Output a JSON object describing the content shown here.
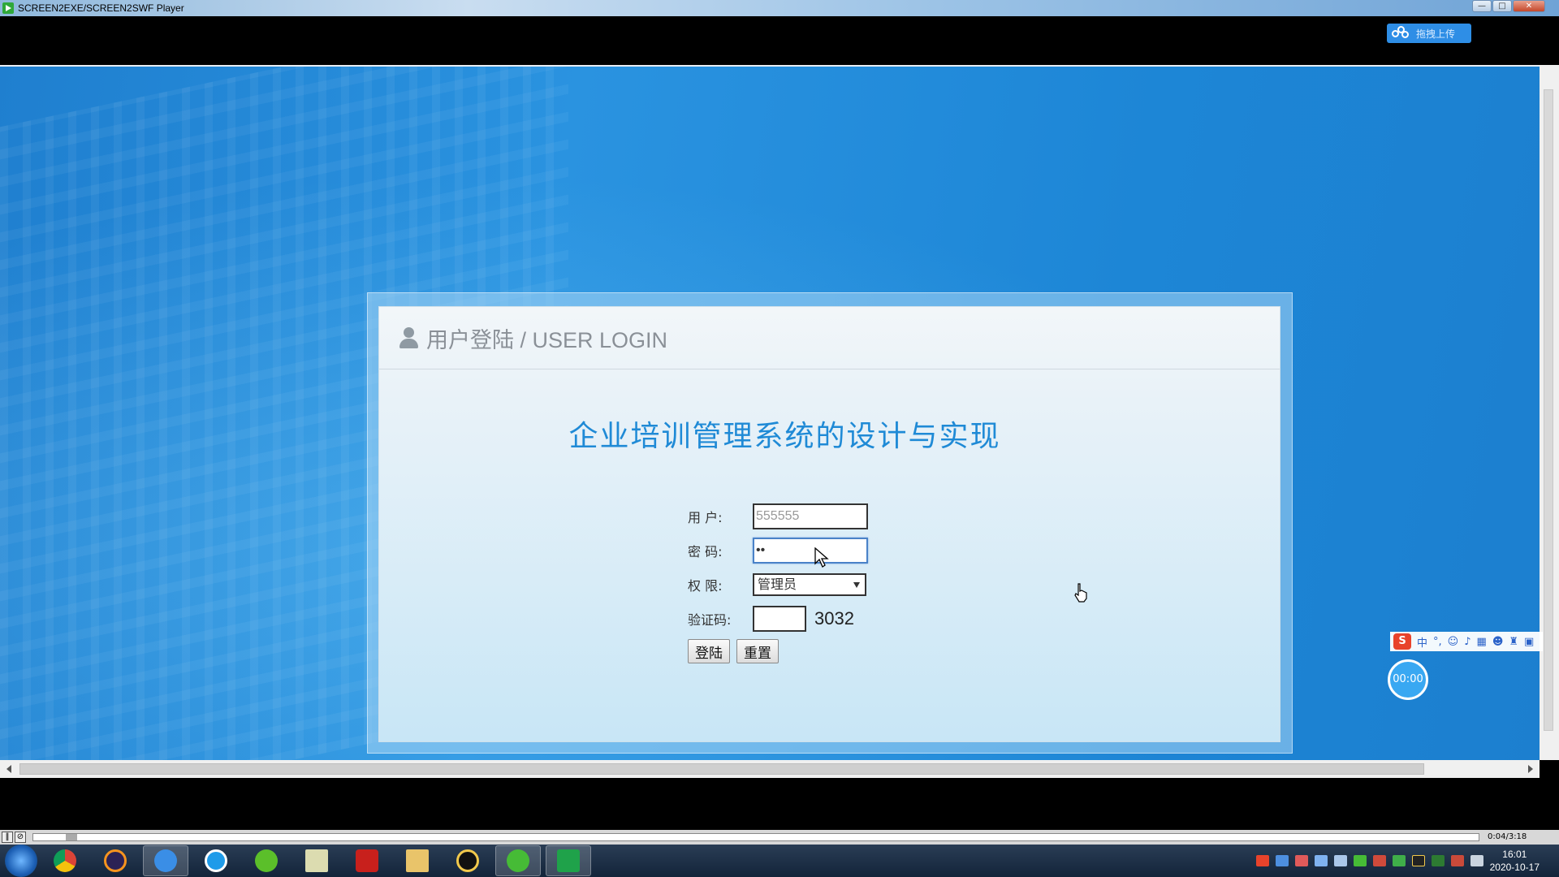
{
  "window": {
    "title": "SCREEN2EXE/SCREEN2SWF Player",
    "controls": [
      "—",
      "□",
      "✕"
    ]
  },
  "toolbar": {
    "upload_label": "拖拽上传"
  },
  "login": {
    "panel_title": "用户登陆 / USER LOGIN",
    "system_title": "企业培训管理系统的设计与实现",
    "user_label": "用 户:",
    "user_value": "555555",
    "password_label": "密 码:",
    "password_value": "••",
    "role_label": "权 限:",
    "role_selected": "管理员",
    "captcha_label": "验证码:",
    "captcha_code": "3032",
    "login_button": "登陆",
    "reset_button": "重置"
  },
  "ime": {
    "logo": "S",
    "mode": "中",
    "punct": "°,"
  },
  "timer": {
    "text": "00:00"
  },
  "player": {
    "time": "0:04/3:18"
  },
  "taskbar": {
    "time": "16:01",
    "date": "2020-10-17"
  },
  "colors": {
    "accent": "#1f8ad6",
    "background": "#1e86d6",
    "upload_button": "#2e8ee6"
  }
}
